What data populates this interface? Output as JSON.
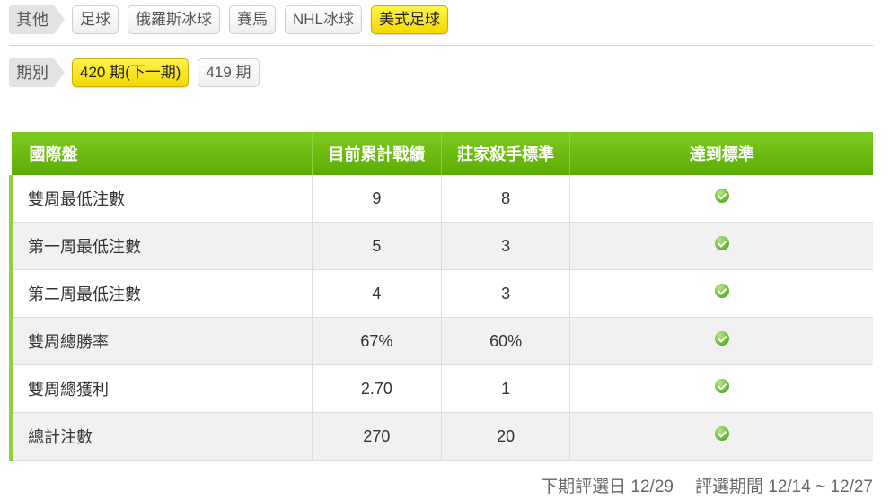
{
  "sport_nav": {
    "label": "其他",
    "items": [
      {
        "label": "足球",
        "active": false
      },
      {
        "label": "俄羅斯冰球",
        "active": false
      },
      {
        "label": "賽馬",
        "active": false
      },
      {
        "label": "NHL冰球",
        "active": false
      },
      {
        "label": "美式足球",
        "active": true
      }
    ]
  },
  "period_nav": {
    "label": "期別",
    "items": [
      {
        "label": "420 期(下一期)",
        "active": true
      },
      {
        "label": "419 期",
        "active": false
      }
    ]
  },
  "table": {
    "headers": [
      "國際盤",
      "目前累計戰績",
      "莊家殺手標準",
      "達到標準"
    ],
    "rows": [
      {
        "name": "雙周最低注數",
        "current": "9",
        "standard": "8",
        "met": true
      },
      {
        "name": "第一周最低注數",
        "current": "5",
        "standard": "3",
        "met": true
      },
      {
        "name": "第二周最低注數",
        "current": "4",
        "standard": "3",
        "met": true
      },
      {
        "name": "雙周總勝率",
        "current": "67%",
        "standard": "60%",
        "met": true
      },
      {
        "name": "雙周總獲利",
        "current": "2.70",
        "standard": "1",
        "met": true
      },
      {
        "name": "總計注數",
        "current": "270",
        "standard": "20",
        "met": true
      }
    ]
  },
  "footer": {
    "next_review": "下期評選日 12/29",
    "review_period": "評選期間 12/14 ~ 12/27"
  },
  "colors": {
    "header_green": "#6fbf12",
    "active_tag_yellow": "#f9e51d",
    "check_green": "#5fb12a"
  }
}
